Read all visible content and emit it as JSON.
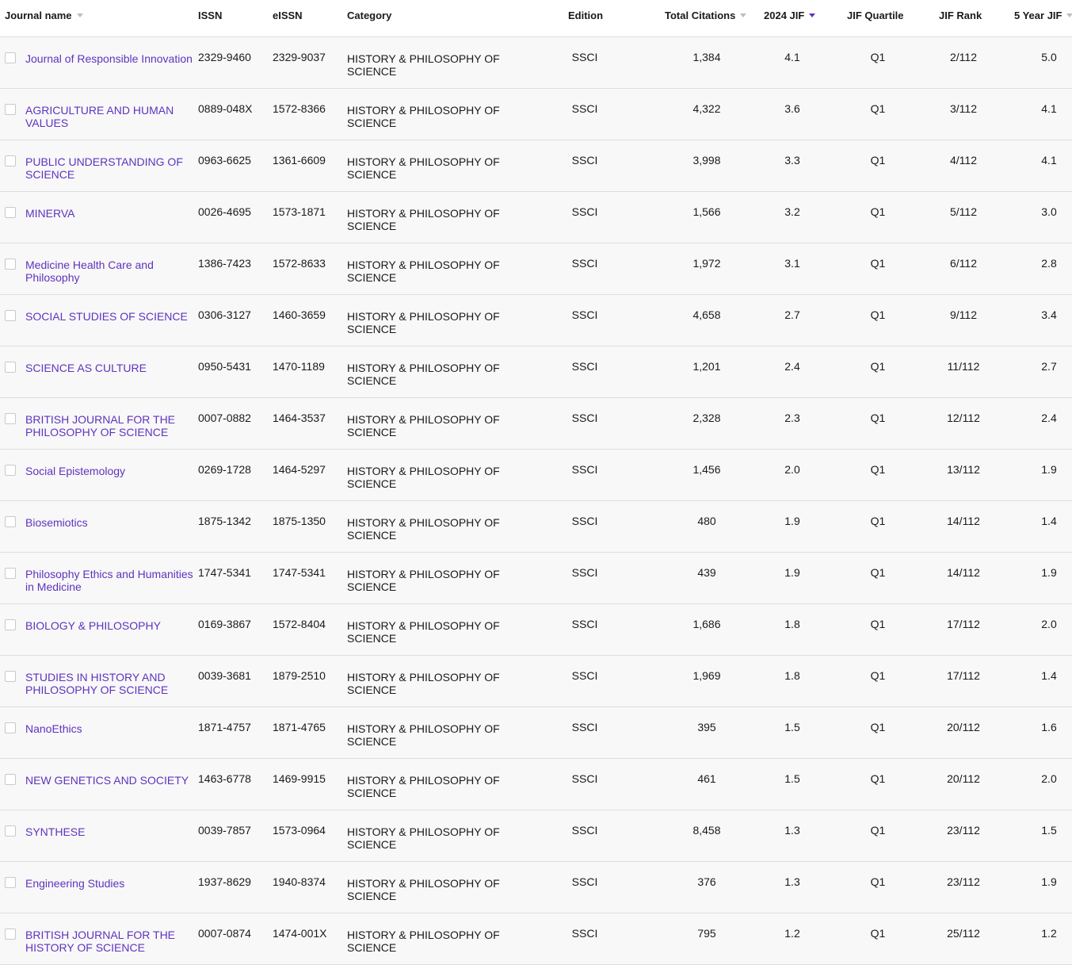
{
  "header": {
    "journal_name": "Journal name",
    "issn": "ISSN",
    "eissn": "eISSN",
    "category": "Category",
    "edition": "Edition",
    "total_citations": "Total Citations",
    "jif_2024": "2024 JIF",
    "jif_quartile": "JIF Quartile",
    "jif_rank": "JIF Rank",
    "five_year_jif": "5 Year JIF"
  },
  "colors": {
    "link": "#5e33bf",
    "sort_active": "#5e33bf",
    "sort_inactive": "#bdbdbd",
    "row_bg": "#f8f8f8",
    "divider": "#dedede"
  },
  "rows": [
    {
      "name": "Journal of Responsible Innovation",
      "issn": "2329-9460",
      "eissn": "2329-9037",
      "category": "HISTORY & PHILOSOPHY OF SCIENCE",
      "edition": "SSCI",
      "citations": "1,384",
      "jif": "4.1",
      "quartile": "Q1",
      "rank": "2/112",
      "five_year": "5.0"
    },
    {
      "name": "AGRICULTURE AND HUMAN VALUES",
      "issn": "0889-048X",
      "eissn": "1572-8366",
      "category": "HISTORY & PHILOSOPHY OF SCIENCE",
      "edition": "SSCI",
      "citations": "4,322",
      "jif": "3.6",
      "quartile": "Q1",
      "rank": "3/112",
      "five_year": "4.1"
    },
    {
      "name": "PUBLIC UNDERSTANDING OF SCIENCE",
      "issn": "0963-6625",
      "eissn": "1361-6609",
      "category": "HISTORY & PHILOSOPHY OF SCIENCE",
      "edition": "SSCI",
      "citations": "3,998",
      "jif": "3.3",
      "quartile": "Q1",
      "rank": "4/112",
      "five_year": "4.1"
    },
    {
      "name": "MINERVA",
      "issn": "0026-4695",
      "eissn": "1573-1871",
      "category": "HISTORY & PHILOSOPHY OF SCIENCE",
      "edition": "SSCI",
      "citations": "1,566",
      "jif": "3.2",
      "quartile": "Q1",
      "rank": "5/112",
      "five_year": "3.0"
    },
    {
      "name": "Medicine Health Care and Philosophy",
      "issn": "1386-7423",
      "eissn": "1572-8633",
      "category": "HISTORY & PHILOSOPHY OF SCIENCE",
      "edition": "SSCI",
      "citations": "1,972",
      "jif": "3.1",
      "quartile": "Q1",
      "rank": "6/112",
      "five_year": "2.8"
    },
    {
      "name": "SOCIAL STUDIES OF SCIENCE",
      "issn": "0306-3127",
      "eissn": "1460-3659",
      "category": "HISTORY & PHILOSOPHY OF SCIENCE",
      "edition": "SSCI",
      "citations": "4,658",
      "jif": "2.7",
      "quartile": "Q1",
      "rank": "9/112",
      "five_year": "3.4"
    },
    {
      "name": "SCIENCE AS CULTURE",
      "issn": "0950-5431",
      "eissn": "1470-1189",
      "category": "HISTORY & PHILOSOPHY OF SCIENCE",
      "edition": "SSCI",
      "citations": "1,201",
      "jif": "2.4",
      "quartile": "Q1",
      "rank": "11/112",
      "five_year": "2.7"
    },
    {
      "name": "BRITISH JOURNAL FOR THE PHILOSOPHY OF SCIENCE",
      "issn": "0007-0882",
      "eissn": "1464-3537",
      "category": "HISTORY & PHILOSOPHY OF SCIENCE",
      "edition": "SSCI",
      "citations": "2,328",
      "jif": "2.3",
      "quartile": "Q1",
      "rank": "12/112",
      "five_year": "2.4"
    },
    {
      "name": "Social Epistemology",
      "issn": "0269-1728",
      "eissn": "1464-5297",
      "category": "HISTORY & PHILOSOPHY OF SCIENCE",
      "edition": "SSCI",
      "citations": "1,456",
      "jif": "2.0",
      "quartile": "Q1",
      "rank": "13/112",
      "five_year": "1.9"
    },
    {
      "name": "Biosemiotics",
      "issn": "1875-1342",
      "eissn": "1875-1350",
      "category": "HISTORY & PHILOSOPHY OF SCIENCE",
      "edition": "SSCI",
      "citations": "480",
      "jif": "1.9",
      "quartile": "Q1",
      "rank": "14/112",
      "five_year": "1.4"
    },
    {
      "name": "Philosophy Ethics and Humanities in Medicine",
      "issn": "1747-5341",
      "eissn": "1747-5341",
      "category": "HISTORY & PHILOSOPHY OF SCIENCE",
      "edition": "SSCI",
      "citations": "439",
      "jif": "1.9",
      "quartile": "Q1",
      "rank": "14/112",
      "five_year": "1.9"
    },
    {
      "name": "BIOLOGY & PHILOSOPHY",
      "issn": "0169-3867",
      "eissn": "1572-8404",
      "category": "HISTORY & PHILOSOPHY OF SCIENCE",
      "edition": "SSCI",
      "citations": "1,686",
      "jif": "1.8",
      "quartile": "Q1",
      "rank": "17/112",
      "five_year": "2.0"
    },
    {
      "name": "STUDIES IN HISTORY AND PHILOSOPHY OF SCIENCE",
      "issn": "0039-3681",
      "eissn": "1879-2510",
      "category": "HISTORY & PHILOSOPHY OF SCIENCE",
      "edition": "SSCI",
      "citations": "1,969",
      "jif": "1.8",
      "quartile": "Q1",
      "rank": "17/112",
      "five_year": "1.4"
    },
    {
      "name": "NanoEthics",
      "issn": "1871-4757",
      "eissn": "1871-4765",
      "category": "HISTORY & PHILOSOPHY OF SCIENCE",
      "edition": "SSCI",
      "citations": "395",
      "jif": "1.5",
      "quartile": "Q1",
      "rank": "20/112",
      "five_year": "1.6"
    },
    {
      "name": "NEW GENETICS AND SOCIETY",
      "issn": "1463-6778",
      "eissn": "1469-9915",
      "category": "HISTORY & PHILOSOPHY OF SCIENCE",
      "edition": "SSCI",
      "citations": "461",
      "jif": "1.5",
      "quartile": "Q1",
      "rank": "20/112",
      "five_year": "2.0"
    },
    {
      "name": "SYNTHESE",
      "issn": "0039-7857",
      "eissn": "1573-0964",
      "category": "HISTORY & PHILOSOPHY OF SCIENCE",
      "edition": "SSCI",
      "citations": "8,458",
      "jif": "1.3",
      "quartile": "Q1",
      "rank": "23/112",
      "five_year": "1.5"
    },
    {
      "name": "Engineering Studies",
      "issn": "1937-8629",
      "eissn": "1940-8374",
      "category": "HISTORY & PHILOSOPHY OF SCIENCE",
      "edition": "SSCI",
      "citations": "376",
      "jif": "1.3",
      "quartile": "Q1",
      "rank": "23/112",
      "five_year": "1.9"
    },
    {
      "name": "BRITISH JOURNAL FOR THE HISTORY OF SCIENCE",
      "issn": "0007-0874",
      "eissn": "1474-001X",
      "category": "HISTORY & PHILOSOPHY OF SCIENCE",
      "edition": "SSCI",
      "citations": "795",
      "jif": "1.2",
      "quartile": "Q1",
      "rank": "25/112",
      "five_year": "1.2"
    }
  ]
}
